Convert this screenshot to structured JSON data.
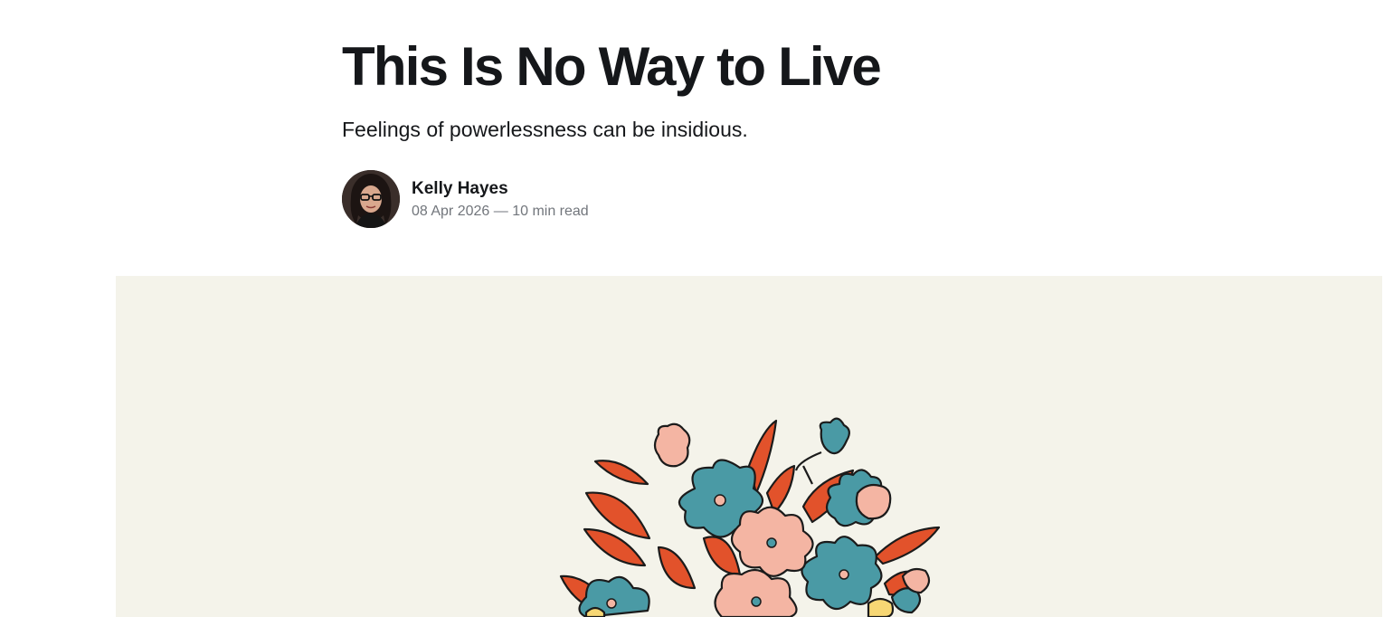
{
  "article": {
    "title": "This Is No Way to Live",
    "subtitle": "Feelings of powerlessness can be insidious.",
    "author": "Kelly Hayes",
    "date": "08 Apr 2026",
    "separator": "—",
    "read_time": "10 min read"
  },
  "feature_image": {
    "description_icon": "floral-bouquet-illustration",
    "background_color": "#f4f3ea",
    "palette": [
      "#4a9aa5",
      "#e2522b",
      "#f4b5a3",
      "#f7d774",
      "#1b1b1b"
    ]
  },
  "colors": {
    "text": "#15171a",
    "muted": "#72767c"
  }
}
